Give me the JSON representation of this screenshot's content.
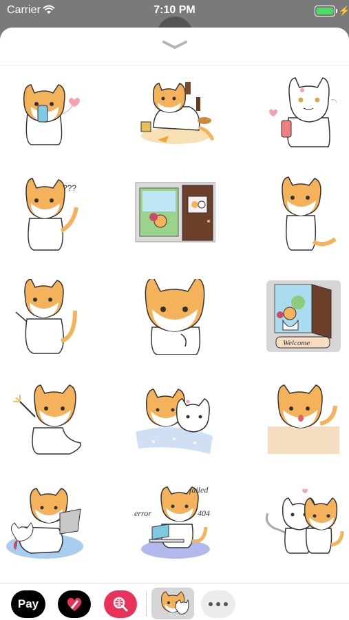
{
  "status_bar": {
    "carrier": "Carrier",
    "time": "7:10 PM"
  },
  "stickers": [
    {
      "name": "cat-phone-heart"
    },
    {
      "name": "cat-junk-food"
    },
    {
      "name": "white-cat-phone-heart"
    },
    {
      "name": "cat-confused",
      "text": "???"
    },
    {
      "name": "cat-window-door"
    },
    {
      "name": "cat-standing"
    },
    {
      "name": "cat-arms-up"
    },
    {
      "name": "cat-thinking"
    },
    {
      "name": "cat-welcome-door",
      "text": "Welcome"
    },
    {
      "name": "cat-sparkler"
    },
    {
      "name": "cats-cuddle-bed"
    },
    {
      "name": "cat-peeking-wall"
    },
    {
      "name": "cats-laptop-rug"
    },
    {
      "name": "cat-error-404",
      "text_a": "error",
      "text_b": "failed",
      "text_c": "404"
    },
    {
      "name": "cats-hugging"
    }
  ],
  "tray": {
    "apple_pay": "Pay",
    "apple_symbol": ""
  },
  "colors": {
    "accent_red": "#e8325a",
    "orange": "#f4b35a"
  }
}
